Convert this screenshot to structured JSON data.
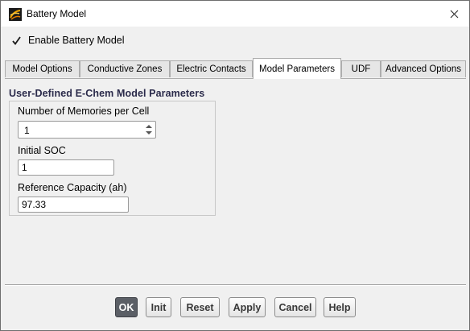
{
  "window": {
    "title": "Battery Model",
    "icon": "ansys-fluent-icon",
    "close_glyph": "✕"
  },
  "enable": {
    "label": "Enable Battery Model",
    "checked": true
  },
  "tabs": [
    {
      "label": "Model Options",
      "active": false
    },
    {
      "label": "Conductive Zones",
      "active": false
    },
    {
      "label": "Electric Contacts",
      "active": false
    },
    {
      "label": "Model Parameters",
      "active": true
    },
    {
      "label": "UDF",
      "active": false
    },
    {
      "label": "Advanced Options",
      "active": false
    }
  ],
  "panel": {
    "group_title": "User-Defined E-Chem Model Parameters",
    "memories": {
      "label": "Number of Memories per Cell",
      "value": "1"
    },
    "soc": {
      "label": "Initial SOC",
      "value": "1"
    },
    "capacity": {
      "label": "Reference Capacity (ah)",
      "value": "97.33"
    }
  },
  "buttons": {
    "ok": "OK",
    "init": "Init",
    "reset": "Reset",
    "apply": "Apply",
    "cancel": "Cancel",
    "help": "Help"
  },
  "colors": {
    "accent_primary_button": "#5b5f66",
    "group_title": "#2b2b4b",
    "window_bg": "#f0f0f0"
  }
}
